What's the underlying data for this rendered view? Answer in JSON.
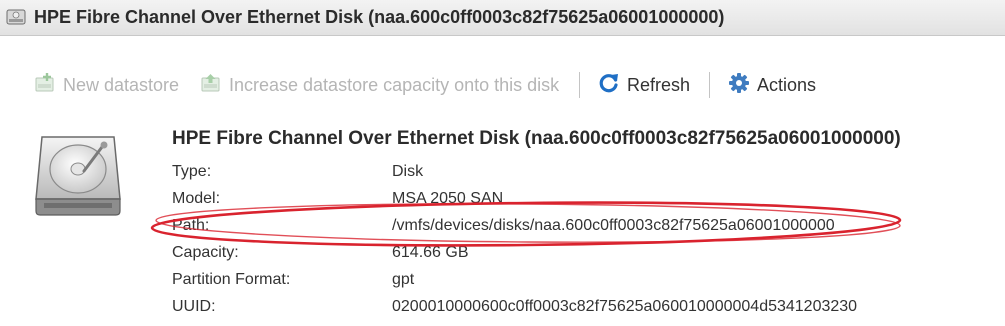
{
  "window": {
    "title": "HPE Fibre Channel Over Ethernet Disk (naa.600c0ff0003c82f75625a06001000000)",
    "icon": "disk-icon"
  },
  "toolbar": {
    "new_datastore": {
      "label": "New datastore",
      "icon": "new-datastore-icon",
      "enabled": false
    },
    "increase_capacity": {
      "label": "Increase datastore capacity onto this disk",
      "icon": "increase-capacity-icon",
      "enabled": false
    },
    "refresh": {
      "label": "Refresh",
      "icon": "refresh-icon",
      "enabled": true
    },
    "actions": {
      "label": "Actions",
      "icon": "gear-icon",
      "enabled": true
    }
  },
  "disk": {
    "header": "HPE Fibre Channel Over Ethernet Disk (naa.600c0ff0003c82f75625a06001000000)",
    "properties": [
      {
        "label": "Type:",
        "value": "Disk"
      },
      {
        "label": "Model:",
        "value": "MSA 2050 SAN"
      },
      {
        "label": "Path:",
        "value": "/vmfs/devices/disks/naa.600c0ff0003c82f75625a06001000000"
      },
      {
        "label": "Capacity:",
        "value": "614.66 GB"
      },
      {
        "label": "Partition Format:",
        "value": "gpt"
      },
      {
        "label": "UUID:",
        "value": "0200010000600c0ff0003c82f75625a060010000004d5341203230"
      }
    ]
  },
  "annotation": {
    "color": "#d9232e",
    "highlight": "Path"
  },
  "colors": {
    "disabled_text": "#b5b5b5",
    "refresh_blue": "#1f6fc5",
    "gear_blue": "#3f7cc0"
  }
}
